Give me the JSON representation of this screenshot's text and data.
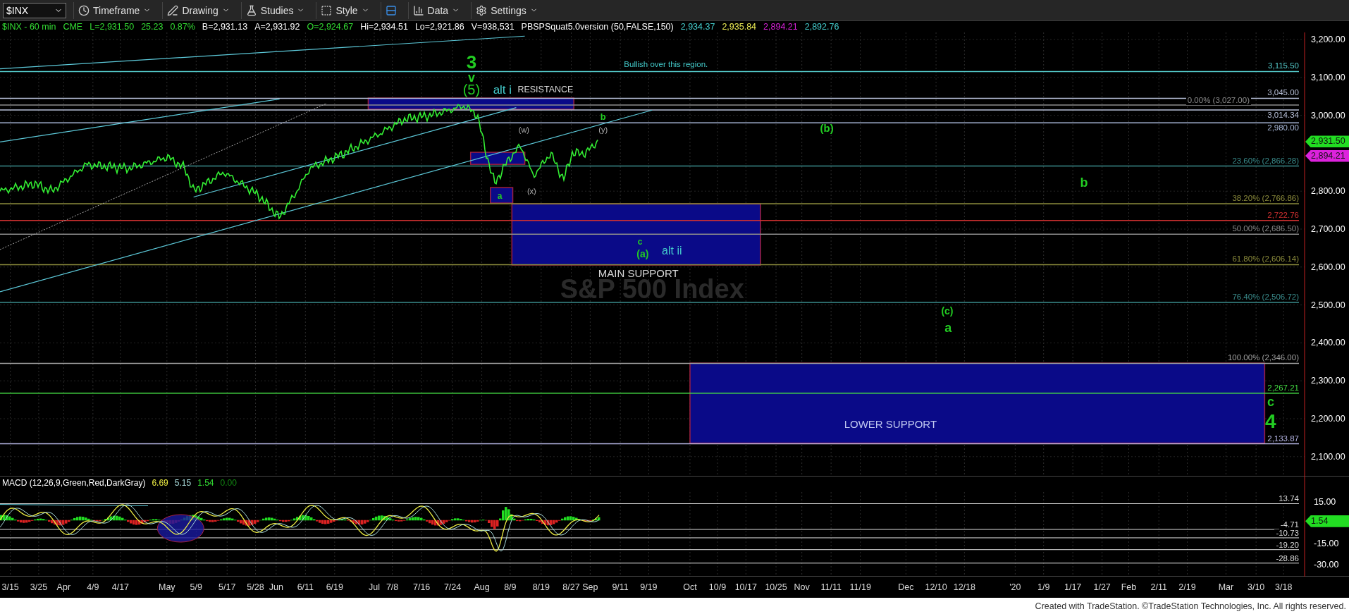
{
  "toolbar": {
    "symbol": "$INX",
    "buttons": [
      "Timeframe",
      "Drawing",
      "Studies",
      "Style",
      "Data",
      "Settings"
    ]
  },
  "header": {
    "items": [
      {
        "text": "$INX - 60 min",
        "color": "#33dd33"
      },
      {
        "text": "CME",
        "color": "#33dd33"
      },
      {
        "text": "L=2,931.50",
        "color": "#33dd33"
      },
      {
        "text": "25.23",
        "color": "#33dd33"
      },
      {
        "text": "0.87%",
        "color": "#33dd33"
      },
      {
        "text": "B=2,931.13",
        "color": "#ffffff"
      },
      {
        "text": "A=2,931.92",
        "color": "#ffffff"
      },
      {
        "text": "O=2,924.67",
        "color": "#33dd33"
      },
      {
        "text": "Hi=2,934.51",
        "color": "#ffffff"
      },
      {
        "text": "Lo=2,921.86",
        "color": "#ffffff"
      },
      {
        "text": "V=938,531",
        "color": "#ffffff"
      },
      {
        "text": "PBSPSquat5.0version (50,FALSE,150)",
        "color": "#ffffff"
      },
      {
        "text": "2,934.37",
        "color": "#44cccc"
      },
      {
        "text": "2,935.84",
        "color": "#eeee55"
      },
      {
        "text": "2,894.21",
        "color": "#dd22dd"
      },
      {
        "text": "2,892.76",
        "color": "#44cccc"
      }
    ]
  },
  "price_panel": {
    "watermark": "S&P 500 Index",
    "axis_ticks": [
      "3,200.00",
      "3,100.00",
      "3,000.00",
      "2,800.00",
      "2,700.00",
      "2,600.00",
      "2,500.00",
      "2,400.00",
      "2,300.00",
      "2,200.00",
      "2,100.00"
    ],
    "price_tags": [
      {
        "text": "2,931.50",
        "color": "#22dd22"
      },
      {
        "text": "2,894.21",
        "color": "#dd22dd"
      }
    ],
    "levels": [
      {
        "label": "3,115.50",
        "color": "#55cccc"
      },
      {
        "label": "3,045.00",
        "color": "#b8c0d8"
      },
      {
        "label": "0.00% (3,027.00)",
        "color": "#8c8c8c"
      },
      {
        "label": "3,014.34",
        "color": "#b8c0d8"
      },
      {
        "label": "2,980.00",
        "color": "#a8b8d8"
      },
      {
        "label": "23.60% (2,866.28)",
        "color": "#3a8c8c"
      },
      {
        "label": "38.20% (2,766.86)",
        "color": "#8c8c3c"
      },
      {
        "label": "2,722.76",
        "color": "#d03030"
      },
      {
        "label": "50.00% (2,686.50)",
        "color": "#8c8c8c"
      },
      {
        "label": "61.80% (2,606.14)",
        "color": "#8c8c3c"
      },
      {
        "label": "76.40% (2,506.72)",
        "color": "#3a8c8c"
      },
      {
        "label": "100.00% (2,346.00)",
        "color": "#a0a0a0"
      },
      {
        "label": "2,267.21",
        "color": "#44dd44"
      },
      {
        "label": "2,133.87",
        "color": "#b8b8e8"
      }
    ],
    "annotations": [
      {
        "text": "3",
        "kind": "wave",
        "color": "#22cc22"
      },
      {
        "text": "v",
        "kind": "wave",
        "color": "#22cc22"
      },
      {
        "text": "(5)",
        "kind": "count",
        "color": "#22cc22"
      },
      {
        "text": "alt i",
        "kind": "alt",
        "color": "#44cccc"
      },
      {
        "text": "RESISTANCE",
        "kind": "zone",
        "color": "#d8d8d8"
      },
      {
        "text": "Bullish over this region.",
        "kind": "note",
        "color": "#44cccc"
      },
      {
        "text": "(w)",
        "kind": "count",
        "color": "#b0b0b0"
      },
      {
        "text": "b",
        "kind": "wave",
        "color": "#22cc22"
      },
      {
        "text": "(y)",
        "kind": "count",
        "color": "#b0b0b0"
      },
      {
        "text": "(x)",
        "kind": "count",
        "color": "#b0b0b0"
      },
      {
        "text": "a",
        "kind": "wave",
        "color": "#22cc22"
      },
      {
        "text": "(b)",
        "kind": "wave",
        "color": "#22cc22"
      },
      {
        "text": "b",
        "kind": "wave",
        "color": "#22cc22"
      },
      {
        "text": "c",
        "kind": "wave",
        "color": "#22cc22"
      },
      {
        "text": "(a)",
        "kind": "wave",
        "color": "#22cc22"
      },
      {
        "text": "alt ii",
        "kind": "alt",
        "color": "#44cccc"
      },
      {
        "text": "MAIN SUPPORT",
        "kind": "zone",
        "color": "#d8d8d8"
      },
      {
        "text": "(c)",
        "kind": "wave",
        "color": "#22cc22"
      },
      {
        "text": "a",
        "kind": "wave",
        "color": "#22cc22"
      },
      {
        "text": "LOWER SUPPORT",
        "kind": "zone",
        "color": "#c0c8f0"
      },
      {
        "text": "c",
        "kind": "wave",
        "color": "#22cc22"
      },
      {
        "text": "4",
        "kind": "wave",
        "color": "#22cc22"
      }
    ]
  },
  "macd_panel": {
    "title": "MACD (12,26,9,Green,Red,DarkGray)",
    "values": [
      {
        "text": "6.69",
        "color": "#eeee44"
      },
      {
        "text": "5.15",
        "color": "#aadddd"
      },
      {
        "text": "1.54",
        "color": "#33dd33"
      },
      {
        "text": "0.00",
        "color": "#118811"
      }
    ],
    "axis_ticks": [
      "15.00",
      "-15.00",
      "-30.00"
    ],
    "levels": [
      "13.74",
      "-4.71",
      "-10.73",
      "-19.20",
      "-28.86"
    ],
    "tag": {
      "text": "1.54",
      "color": "#22dd22"
    }
  },
  "date_axis": [
    "3/15",
    "3/25",
    "Apr",
    "4/9",
    "4/17",
    "May",
    "5/9",
    "5/17",
    "5/28",
    "Jun",
    "6/11",
    "6/19",
    "Jul",
    "7/8",
    "7/16",
    "7/24",
    "Aug",
    "8/9",
    "8/19",
    "8/27",
    "Sep",
    "9/11",
    "9/19",
    "Oct",
    "10/9",
    "10/17",
    "10/25",
    "Nov",
    "11/11",
    "11/19",
    "Dec",
    "12/10",
    "12/18",
    "'20",
    "1/9",
    "1/17",
    "1/27",
    "Feb",
    "2/11",
    "2/19",
    "Mar",
    "3/10",
    "3/18"
  ],
  "footer": "Created with TradeStation. ©TradeStation Technologies, Inc. All rights reserved."
}
